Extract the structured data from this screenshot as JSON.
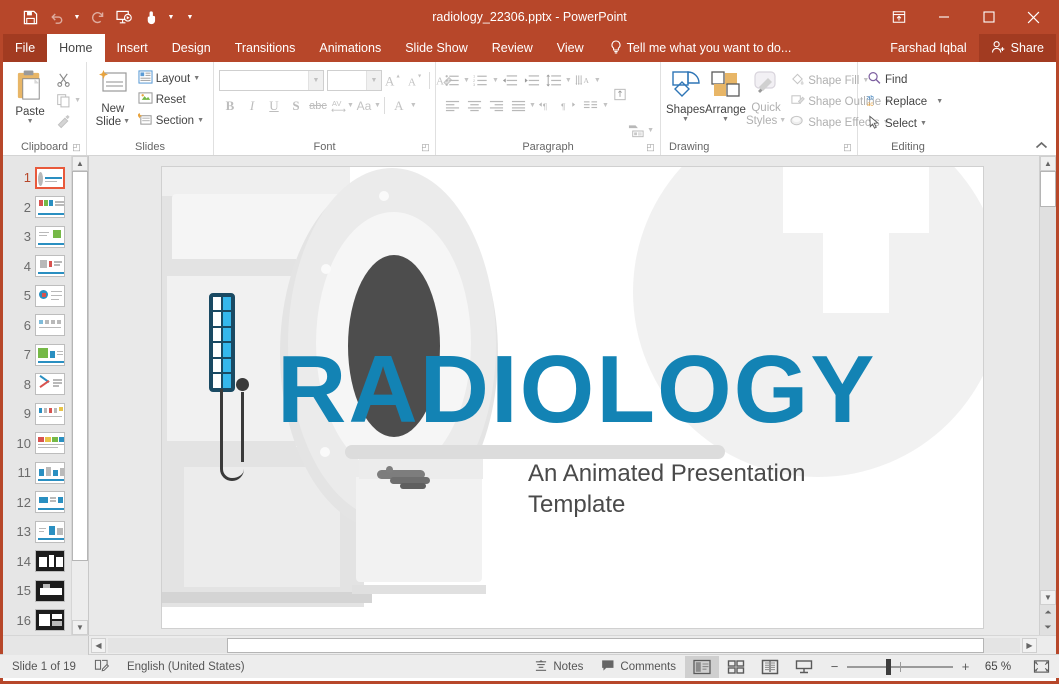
{
  "theme": {
    "accent": "#B7472A",
    "accent_dark": "#A23B21",
    "slide_blue": "#1383B4"
  },
  "titlebar": {
    "document_title": "radiology_22306.pptx - PowerPoint",
    "quick_access": [
      {
        "name": "save",
        "label": "Save"
      },
      {
        "name": "undo",
        "label": "Undo"
      },
      {
        "name": "redo",
        "label": "Redo"
      },
      {
        "name": "start-from-beginning",
        "label": "Start From Beginning"
      },
      {
        "name": "touch-mouse-mode",
        "label": "Touch/Mouse Mode"
      },
      {
        "name": "customize-quick-access-toolbar",
        "label": "Customize Quick Access Toolbar"
      }
    ],
    "window_controls": {
      "ribbon_display_options": "Ribbon Display Options",
      "minimize": "Minimize",
      "restore": "Restore Down",
      "close": "Close"
    }
  },
  "tabs": [
    {
      "label": "File",
      "active": false,
      "file": true
    },
    {
      "label": "Home",
      "active": true
    },
    {
      "label": "Insert",
      "active": false
    },
    {
      "label": "Design",
      "active": false
    },
    {
      "label": "Transitions",
      "active": false
    },
    {
      "label": "Animations",
      "active": false
    },
    {
      "label": "Slide Show",
      "active": false
    },
    {
      "label": "Review",
      "active": false
    },
    {
      "label": "View",
      "active": false
    }
  ],
  "tell_me": {
    "placeholder": "Tell me what you want to do..."
  },
  "account": {
    "user_name": "Farshad Iqbal",
    "share_label": "Share"
  },
  "ribbon": {
    "collapse_label": "Collapse the Ribbon",
    "groups": [
      {
        "label": "Clipboard",
        "paste_label": "Paste",
        "items": [
          {
            "label": "Cut"
          },
          {
            "label": "Copy"
          },
          {
            "label": "Format Painter"
          }
        ]
      },
      {
        "label": "Slides",
        "new_slide_line1": "New",
        "new_slide_line2": "Slide",
        "items": [
          {
            "label": "Layout"
          },
          {
            "label": "Reset"
          },
          {
            "label": "Section"
          }
        ]
      },
      {
        "label": "Font",
        "font_name_value": "",
        "font_name_placeholder": "",
        "font_size_value": "",
        "font_size_placeholder": "",
        "items": [
          {
            "label": "Increase Font Size"
          },
          {
            "label": "Decrease Font Size"
          },
          {
            "label": "Clear All Formatting"
          },
          {
            "label": "Bold"
          },
          {
            "label": "Italic"
          },
          {
            "label": "Underline"
          },
          {
            "label": "Text Shadow"
          },
          {
            "label": "Strikethrough"
          },
          {
            "label": "Character Spacing"
          },
          {
            "label": "Change Case"
          },
          {
            "label": "Font Color"
          }
        ]
      },
      {
        "label": "Paragraph",
        "items": [
          {
            "label": "Bullets"
          },
          {
            "label": "Numbering"
          },
          {
            "label": "Decrease List Level"
          },
          {
            "label": "Increase List Level"
          },
          {
            "label": "Line Spacing"
          },
          {
            "label": "Text Direction"
          },
          {
            "label": "Align Text"
          },
          {
            "label": "Convert to SmartArt"
          },
          {
            "label": "Align Left"
          },
          {
            "label": "Center"
          },
          {
            "label": "Align Right"
          },
          {
            "label": "Justify"
          },
          {
            "label": "Columns"
          },
          {
            "label": "Left-to-Right"
          },
          {
            "label": "Right-to-Left"
          }
        ]
      },
      {
        "label": "Drawing",
        "shapes_label": "Shapes",
        "arrange_label": "Arrange",
        "quick_styles_line1": "Quick",
        "quick_styles_line2": "Styles",
        "items": [
          {
            "label": "Shape Fill"
          },
          {
            "label": "Shape Outline"
          },
          {
            "label": "Shape Effects"
          }
        ]
      },
      {
        "label": "Editing",
        "items": [
          {
            "label": "Find"
          },
          {
            "label": "Replace"
          },
          {
            "label": "Select"
          }
        ]
      }
    ]
  },
  "slide_panel": {
    "slides": [
      {
        "number": "1",
        "selected": true,
        "style": "title"
      },
      {
        "number": "2",
        "selected": false,
        "style": "content-a"
      },
      {
        "number": "3",
        "selected": false,
        "style": "content-b"
      },
      {
        "number": "4",
        "selected": false,
        "style": "content-c"
      },
      {
        "number": "5",
        "selected": false,
        "style": "content-d"
      },
      {
        "number": "6",
        "selected": false,
        "style": "content-e"
      },
      {
        "number": "7",
        "selected": false,
        "style": "content-f"
      },
      {
        "number": "8",
        "selected": false,
        "style": "content-g"
      },
      {
        "number": "9",
        "selected": false,
        "style": "content-h"
      },
      {
        "number": "10",
        "selected": false,
        "style": "content-i"
      },
      {
        "number": "11",
        "selected": false,
        "style": "content-j"
      },
      {
        "number": "12",
        "selected": false,
        "style": "content-k"
      },
      {
        "number": "13",
        "selected": false,
        "style": "content-l"
      },
      {
        "number": "14",
        "selected": false,
        "style": "dark-a"
      },
      {
        "number": "15",
        "selected": false,
        "style": "dark-b"
      },
      {
        "number": "16",
        "selected": false,
        "style": "dark-c"
      }
    ]
  },
  "slide": {
    "title": "RADIOLOGY",
    "subtitle": "An Animated Presentation Template",
    "title_color": "#1383B4",
    "subtitle_color": "#4A4A4A"
  },
  "statusbar": {
    "slide_indicator": "Slide 1 of 19",
    "spell_check_label": "Spelling Check",
    "language": "English (United States)",
    "notes_label": "Notes",
    "comments_label": "Comments",
    "views": [
      {
        "name": "normal-view",
        "label": "Normal",
        "active": true
      },
      {
        "name": "slide-sorter-view",
        "label": "Slide Sorter",
        "active": false
      },
      {
        "name": "reading-view",
        "label": "Reading View",
        "active": false
      },
      {
        "name": "slide-show-view",
        "label": "Slide Show",
        "active": false
      }
    ],
    "zoom_out_label": "−",
    "zoom_in_label": "+",
    "zoom_level": "65 %",
    "fit_label": "Fit slide to current window"
  }
}
